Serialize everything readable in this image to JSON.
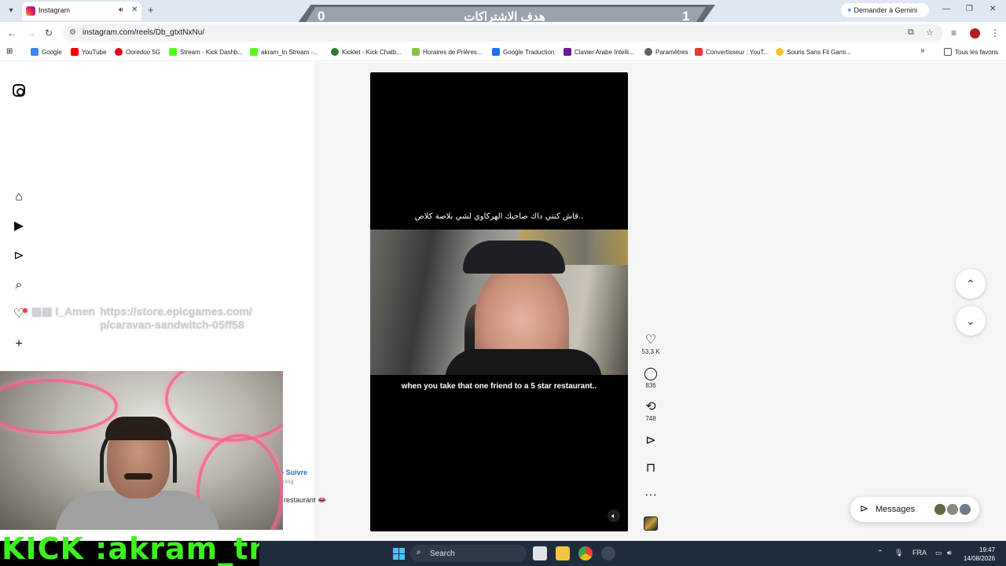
{
  "browser": {
    "tab": {
      "title": "Instagram"
    },
    "address": "instagram.com/reels/Db_gtxtNxNu/",
    "gemini_label": "Demander à Gemini",
    "bookmarks": [
      "Google",
      "YouTube",
      "Ooredoo 5G",
      "Stream - Kick Dashb...",
      "akram_tn Stream -...",
      "Kicklet - Kick Chatb...",
      "Horaires de Prières...",
      "Google Traduction",
      "Clavier Arabe Intelli...",
      "Paramètres",
      "Convertisseur : YouT...",
      "Souris Sans Fil Gami..."
    ],
    "all_bookmarks": "Tous les favoris"
  },
  "goal_overlay": {
    "left_value": "0",
    "title": "هدف الاشتراكات",
    "right_value": "1"
  },
  "stream_overlay": {
    "user": "I_Amen",
    "link_line1": "https://store.epicgames.com/",
    "link_line2": "p/caravan-sandwitch-05ff58",
    "kick_label": "KICK :akram_tn"
  },
  "reel": {
    "top_caption": "قاش كنتي داك صاحبك الهركاوي لشي بلاصة كلاص..",
    "bottom_caption": "when you take that one friend to a 5 star restaurant..",
    "likes": "53,3 K",
    "comments": "836",
    "reposts": "748"
  },
  "side_info": {
    "follow": "• Suivre",
    "sub": "rling",
    "caption": "restaurant 👄"
  },
  "messages_label": "Messages",
  "taskbar": {
    "search": "Search",
    "lang": "FRA",
    "time": "19:47",
    "date": "14/08/2026"
  },
  "colors": {
    "accent_kick": "#3df21c",
    "instagram_notif": "#ff3040",
    "taskbar": "#1f2c3d"
  }
}
